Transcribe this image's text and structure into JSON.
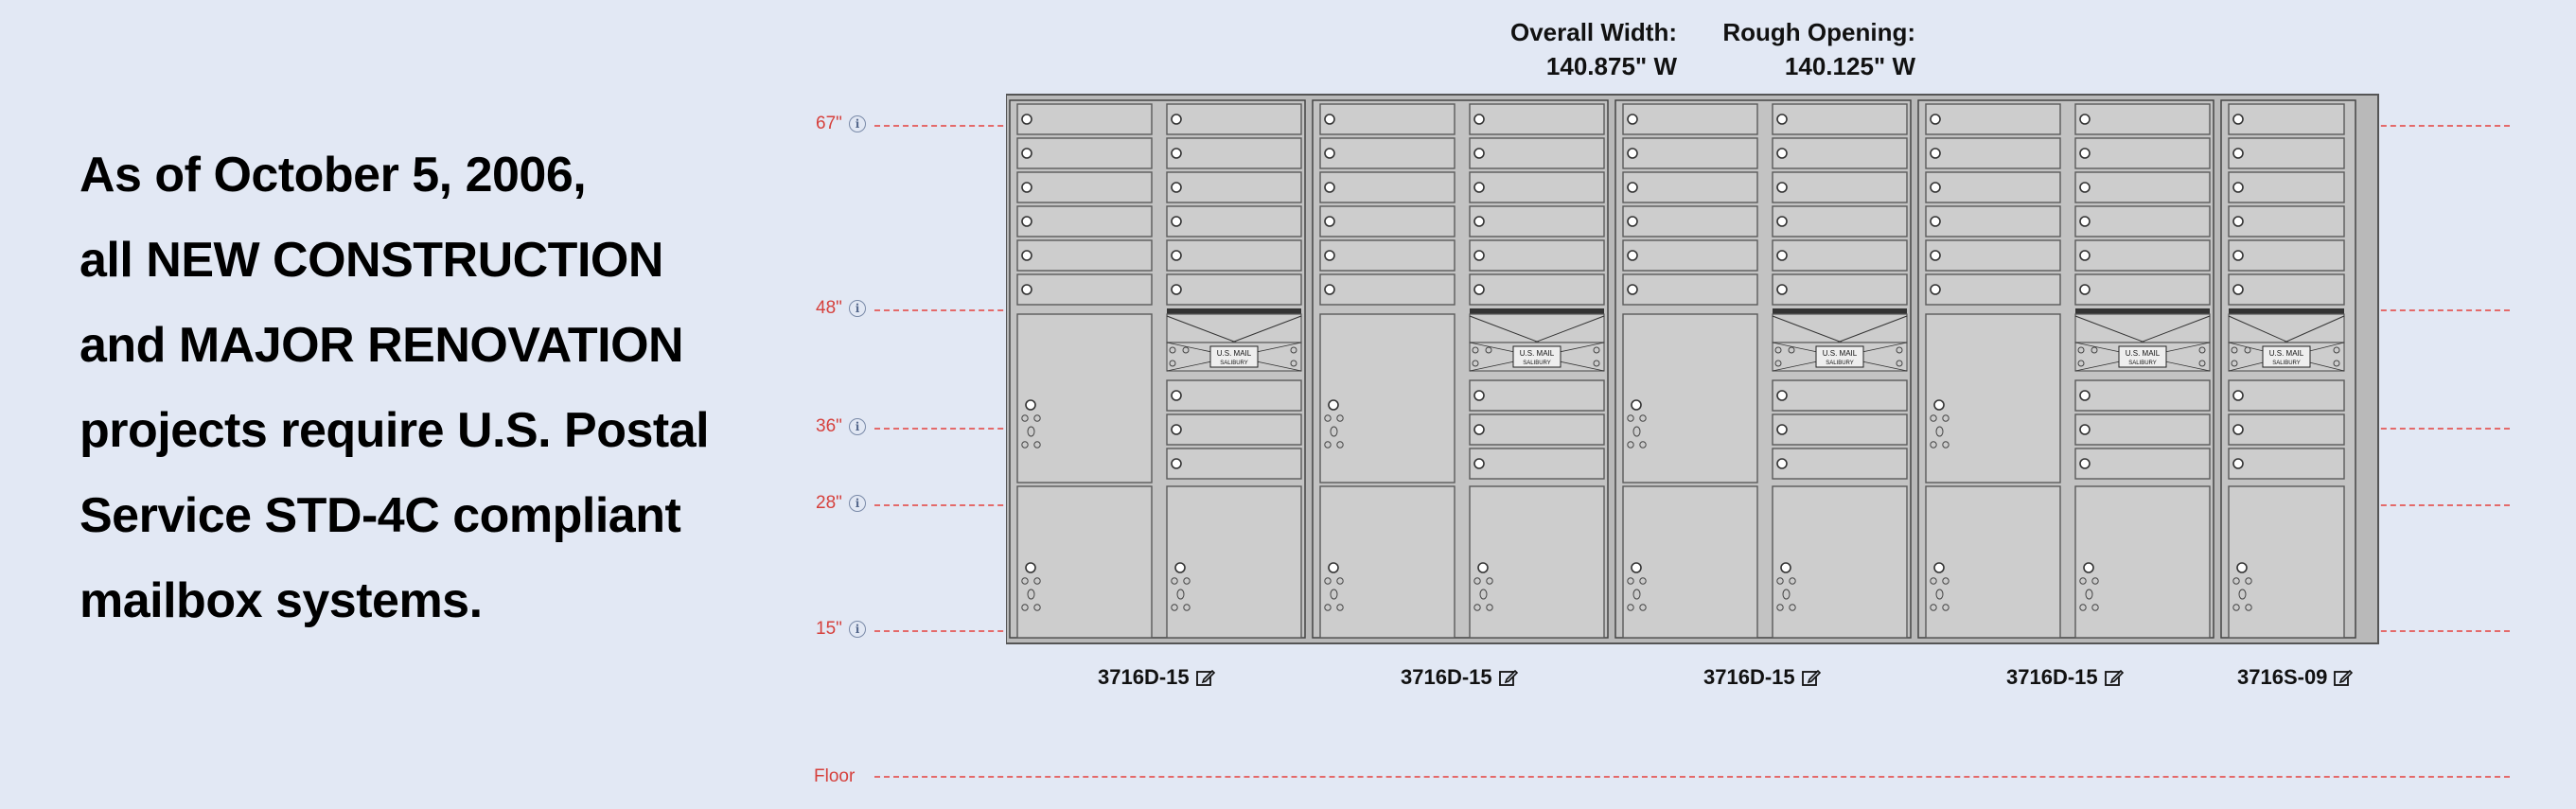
{
  "headline": {
    "lines": [
      "As of October 5, 2006,",
      "all NEW CONSTRUCTION",
      "and MAJOR RENOVATION",
      "projects require U.S. Postal",
      "Service STD-4C compliant",
      "mailbox systems."
    ]
  },
  "dimensions": {
    "overall_width_label": "Overall Width:",
    "overall_width_value": "140.875\" W",
    "rough_opening_label": "Rough Opening:",
    "rough_opening_value": "140.125\" W"
  },
  "levels": [
    {
      "label": "67\"",
      "inches": 67
    },
    {
      "label": "48\"",
      "inches": 48
    },
    {
      "label": "36\"",
      "inches": 36
    },
    {
      "label": "28\"",
      "inches": 28
    },
    {
      "label": "15\"",
      "inches": 15
    }
  ],
  "floor": {
    "label": "Floor",
    "inches": 0
  },
  "units": [
    {
      "model": "3716D-15",
      "type": "double"
    },
    {
      "model": "3716D-15",
      "type": "double"
    },
    {
      "model": "3716D-15",
      "type": "double"
    },
    {
      "model": "3716D-15",
      "type": "double"
    },
    {
      "model": "3716S-09",
      "type": "single"
    }
  ],
  "mail_slot_label": "U.S. MAIL",
  "mail_slot_sublabel": "SALIBURY",
  "colors": {
    "panel": "#cdcdcd",
    "frame": "#b9b9b9",
    "line": "#5a5a5a",
    "level_line": "#e46a6a",
    "level_text": "#d6403c"
  }
}
